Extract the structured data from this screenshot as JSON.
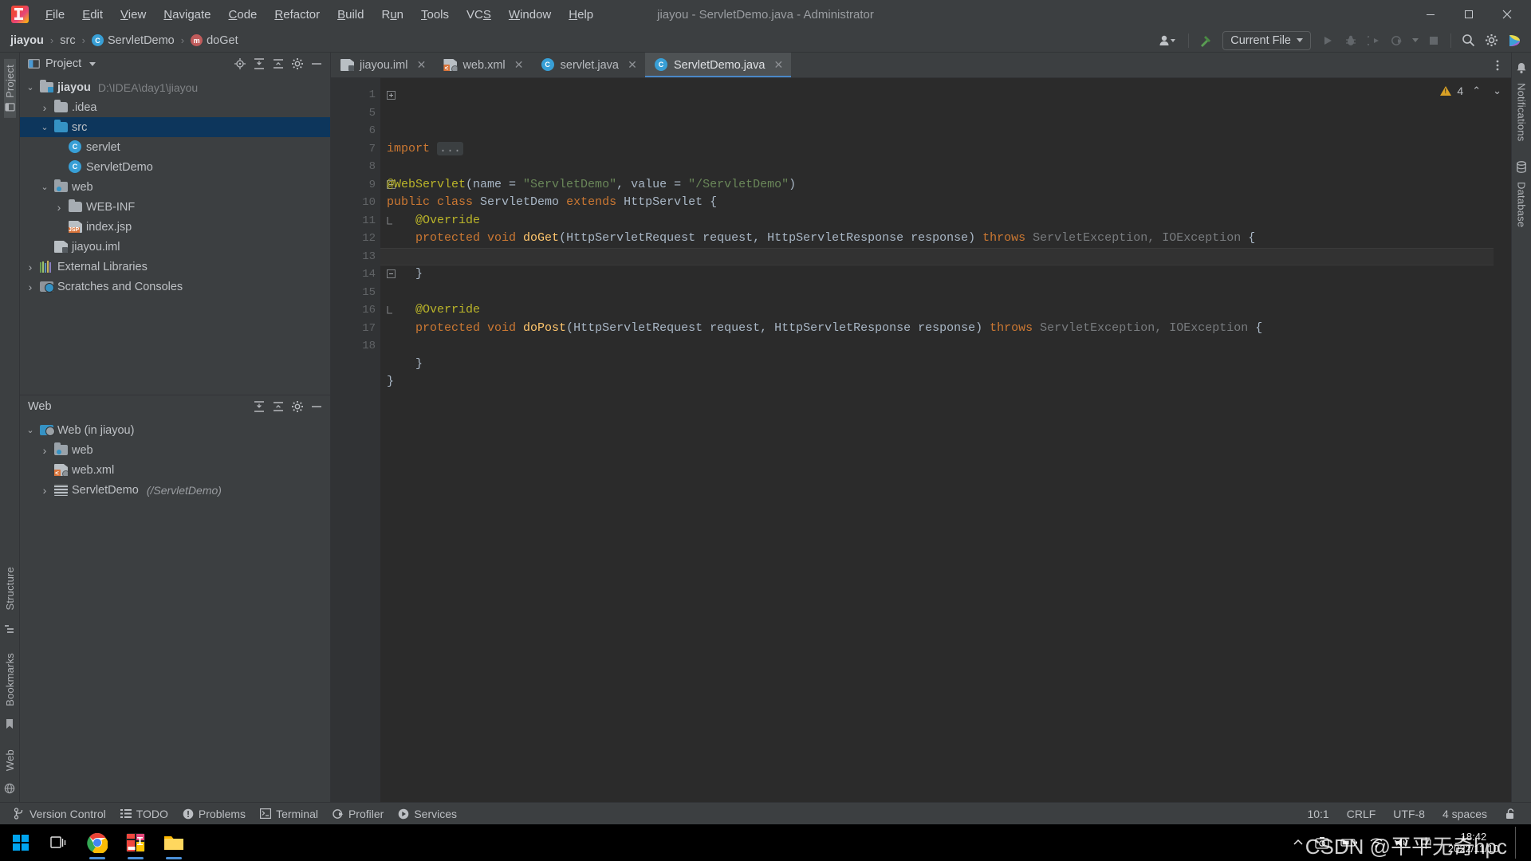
{
  "window": {
    "title": "jiayou - ServletDemo.java - Administrator",
    "minimize": "—",
    "maximize": "▢",
    "close": "✕"
  },
  "menu": {
    "items": [
      {
        "label": "File",
        "mnemonic": "F"
      },
      {
        "label": "Edit",
        "mnemonic": "E"
      },
      {
        "label": "View",
        "mnemonic": "V"
      },
      {
        "label": "Navigate",
        "mnemonic": "N"
      },
      {
        "label": "Code",
        "mnemonic": "C"
      },
      {
        "label": "Refactor",
        "mnemonic": "R"
      },
      {
        "label": "Build",
        "mnemonic": "B"
      },
      {
        "label": "Run",
        "mnemonic": "u"
      },
      {
        "label": "Tools",
        "mnemonic": "T"
      },
      {
        "label": "VCS",
        "mnemonic": "S"
      },
      {
        "label": "Window",
        "mnemonic": "W"
      },
      {
        "label": "Help",
        "mnemonic": "H"
      }
    ]
  },
  "navbar": {
    "breadcrumbs": [
      {
        "label": "jiayou",
        "icon": "none",
        "bold": true
      },
      {
        "label": "src",
        "icon": "none",
        "bold": false
      },
      {
        "label": "ServletDemo",
        "icon": "class-icon",
        "bold": false
      },
      {
        "label": "doGet",
        "icon": "method-icon",
        "bold": false
      }
    ],
    "separator": "›",
    "run_config": "Current File",
    "actions": [
      "user-icon",
      "build-hammer-icon",
      "run-icon",
      "debug-icon",
      "run-coverage-icon",
      "profile-icon",
      "stop-icon",
      "search-everywhere-icon",
      "settings-gear-icon",
      "ide-assistant-icon"
    ]
  },
  "left_strip": {
    "top": [
      "Project"
    ],
    "bottom": [
      "Structure",
      "Bookmarks",
      "Web"
    ]
  },
  "right_strip": {
    "items": [
      "Notifications",
      "Database"
    ]
  },
  "project_panel": {
    "title": "Project",
    "actions": [
      "locate-icon",
      "expand-all-icon",
      "collapse-all-icon",
      "settings-gear-icon",
      "hide-icon"
    ],
    "tree": [
      {
        "label": "jiayou",
        "path": "D:\\IDEA\\day1\\jiayou",
        "icon": "module-icon",
        "indent": 0,
        "arrow": "down",
        "bold": true,
        "selected": false
      },
      {
        "label": ".idea",
        "path": "",
        "icon": "folder-icon",
        "indent": 1,
        "arrow": "right",
        "bold": false,
        "selected": false
      },
      {
        "label": "src",
        "path": "",
        "icon": "source-folder-icon",
        "indent": 1,
        "arrow": "down",
        "bold": false,
        "selected": true
      },
      {
        "label": "servlet",
        "path": "",
        "icon": "class-icon",
        "indent": 2,
        "arrow": "none",
        "bold": false,
        "selected": false
      },
      {
        "label": "ServletDemo",
        "path": "",
        "icon": "class-icon",
        "indent": 2,
        "arrow": "none",
        "bold": false,
        "selected": false
      },
      {
        "label": "web",
        "path": "",
        "icon": "web-folder-icon",
        "indent": 1,
        "arrow": "down",
        "bold": false,
        "selected": false
      },
      {
        "label": "WEB-INF",
        "path": "",
        "icon": "folder-icon",
        "indent": 2,
        "arrow": "right",
        "bold": false,
        "selected": false
      },
      {
        "label": "index.jsp",
        "path": "",
        "icon": "jsp-file-icon",
        "indent": 2,
        "arrow": "none",
        "bold": false,
        "selected": false
      },
      {
        "label": "jiayou.iml",
        "path": "",
        "icon": "iml-file-icon",
        "indent": 1,
        "arrow": "none",
        "bold": false,
        "selected": false
      },
      {
        "label": "External Libraries",
        "path": "",
        "icon": "library-icon",
        "indent": 0,
        "arrow": "right",
        "bold": false,
        "selected": false
      },
      {
        "label": "Scratches and Consoles",
        "path": "",
        "icon": "scratch-icon",
        "indent": 0,
        "arrow": "right",
        "bold": false,
        "selected": false
      }
    ]
  },
  "web_panel": {
    "title": "Web",
    "actions": [
      "expand-all-icon",
      "collapse-all-icon",
      "settings-gear-icon",
      "hide-icon"
    ],
    "tree": [
      {
        "label": "Web (in jiayou)",
        "suffix": "",
        "icon": "web-module-icon",
        "indent": 0,
        "arrow": "down"
      },
      {
        "label": "web",
        "suffix": "",
        "icon": "web-folder-icon",
        "indent": 1,
        "arrow": "right"
      },
      {
        "label": "web.xml",
        "suffix": "",
        "icon": "xml-file-icon",
        "indent": 1,
        "arrow": "none"
      },
      {
        "label": "ServletDemo",
        "suffix": "(/ServletDemo)",
        "icon": "servlet-icon",
        "indent": 1,
        "arrow": "right"
      }
    ]
  },
  "editor": {
    "tabs": [
      {
        "label": "jiayou.iml",
        "icon": "iml-file-icon",
        "active": false,
        "close": "✕"
      },
      {
        "label": "web.xml",
        "icon": "xml-file-icon",
        "active": false,
        "close": "✕"
      },
      {
        "label": "servlet.java",
        "icon": "class-icon",
        "active": false,
        "close": "✕"
      },
      {
        "label": "ServletDemo.java",
        "icon": "class-icon",
        "active": true,
        "close": "✕"
      }
    ],
    "more_tabs_icon": "more-vertical-icon",
    "inspection": {
      "warning_count": "4",
      "warning_icon": "warning-triangle-icon",
      "prev_icon": "⌃",
      "next_icon": "⌄"
    },
    "line_numbers": [
      "1",
      "5",
      "6",
      "7",
      "8",
      "9",
      "10",
      "11",
      "12",
      "13",
      "14",
      "15",
      "16",
      "17",
      "18"
    ],
    "lines": [
      {
        "num": "1",
        "fold": "plus",
        "gutter": "",
        "current": false,
        "tokens": [
          {
            "t": "import",
            "c": "k"
          },
          {
            "t": " ",
            "c": "t"
          },
          {
            "t": "...",
            "c": "foldbox"
          }
        ]
      },
      {
        "num": "5",
        "fold": "",
        "gutter": "",
        "current": false,
        "tokens": []
      },
      {
        "num": "6",
        "fold": "",
        "gutter": "",
        "current": false,
        "tokens": [
          {
            "t": "@WebServlet",
            "c": "an"
          },
          {
            "t": "(name = ",
            "c": "t"
          },
          {
            "t": "\"ServletDemo\"",
            "c": "s"
          },
          {
            "t": ", value = ",
            "c": "t"
          },
          {
            "t": "\"/ServletDemo\"",
            "c": "s"
          },
          {
            "t": ")",
            "c": "t"
          }
        ]
      },
      {
        "num": "7",
        "fold": "",
        "gutter": "web-marker-icon",
        "current": false,
        "tokens": [
          {
            "t": "public class ",
            "c": "k"
          },
          {
            "t": "ServletDemo ",
            "c": "t"
          },
          {
            "t": "extends ",
            "c": "k"
          },
          {
            "t": "HttpServlet {",
            "c": "t"
          }
        ]
      },
      {
        "num": "8",
        "fold": "",
        "gutter": "",
        "current": false,
        "tokens": [
          {
            "t": "    @Override",
            "c": "an"
          }
        ]
      },
      {
        "num": "9",
        "fold": "minus",
        "gutter": "override-method-icon",
        "current": false,
        "tokens": [
          {
            "t": "    ",
            "c": "t"
          },
          {
            "t": "protected void ",
            "c": "k"
          },
          {
            "t": "doGet",
            "c": "fn"
          },
          {
            "t": "(HttpServletRequest request, HttpServletResponse response) ",
            "c": "t"
          },
          {
            "t": "throws ",
            "c": "k"
          },
          {
            "t": "ServletException, IOException ",
            "c": "dim"
          },
          {
            "t": "{",
            "c": "t"
          }
        ]
      },
      {
        "num": "10",
        "fold": "",
        "gutter": "",
        "current": true,
        "tokens": []
      },
      {
        "num": "11",
        "fold": "end",
        "gutter": "",
        "current": false,
        "tokens": [
          {
            "t": "    }",
            "c": "t"
          }
        ]
      },
      {
        "num": "12",
        "fold": "",
        "gutter": "",
        "current": false,
        "tokens": []
      },
      {
        "num": "13",
        "fold": "",
        "gutter": "",
        "current": false,
        "tokens": [
          {
            "t": "    @Override",
            "c": "an"
          }
        ]
      },
      {
        "num": "14",
        "fold": "minus",
        "gutter": "override-method-icon",
        "current": false,
        "tokens": [
          {
            "t": "    ",
            "c": "t"
          },
          {
            "t": "protected void ",
            "c": "k"
          },
          {
            "t": "doPost",
            "c": "fn"
          },
          {
            "t": "(HttpServletRequest request, HttpServletResponse response) ",
            "c": "t"
          },
          {
            "t": "throws ",
            "c": "k"
          },
          {
            "t": "ServletException, IOException ",
            "c": "dim"
          },
          {
            "t": "{",
            "c": "t"
          }
        ]
      },
      {
        "num": "15",
        "fold": "",
        "gutter": "",
        "current": false,
        "tokens": []
      },
      {
        "num": "16",
        "fold": "end",
        "gutter": "",
        "current": false,
        "tokens": [
          {
            "t": "    }",
            "c": "t"
          }
        ]
      },
      {
        "num": "17",
        "fold": "",
        "gutter": "",
        "current": false,
        "tokens": [
          {
            "t": "}",
            "c": "t"
          }
        ]
      },
      {
        "num": "18",
        "fold": "",
        "gutter": "",
        "current": false,
        "tokens": []
      }
    ]
  },
  "statusbar": {
    "left_items": [
      {
        "label": "Version Control",
        "icon": "branch-icon"
      },
      {
        "label": "TODO",
        "icon": "todo-list-icon"
      },
      {
        "label": "Problems",
        "icon": "problems-icon"
      },
      {
        "label": "Terminal",
        "icon": "terminal-icon"
      },
      {
        "label": "Profiler",
        "icon": "profiler-icon"
      },
      {
        "label": "Services",
        "icon": "services-icon"
      }
    ],
    "right_items": [
      {
        "label": "10:1",
        "name": "caret-position"
      },
      {
        "label": "CRLF",
        "name": "line-separator"
      },
      {
        "label": "UTF-8",
        "name": "file-encoding"
      },
      {
        "label": "4 spaces",
        "name": "indent-setting"
      }
    ],
    "lock_icon": "lock-icon"
  },
  "taskbar": {
    "start_icon": "windows-start-icon",
    "task_view_icon": "task-view-icon",
    "apps": [
      {
        "name": "chrome-icon",
        "running": true
      },
      {
        "name": "intellij-idea-icon",
        "running": true
      },
      {
        "name": "file-explorer-icon",
        "running": true
      }
    ],
    "tray": [
      "show-hidden-icons-icon",
      "screenshot-icon",
      "battery-icon",
      "wifi-icon",
      "volume-icon",
      "ime-icon"
    ],
    "time": "18:42",
    "date": "2022/11/10",
    "watermark": "CSDN @平平无奇hpc"
  },
  "colors": {
    "accent": "#4a88c7",
    "selection": "#0d365c",
    "editor_bg": "#2b2b2b",
    "panel_bg": "#3c3f41",
    "keyword": "#cc7832",
    "string": "#6a8759",
    "annotation": "#bbb529",
    "method": "#ffc66d",
    "warning": "#d9a125"
  }
}
